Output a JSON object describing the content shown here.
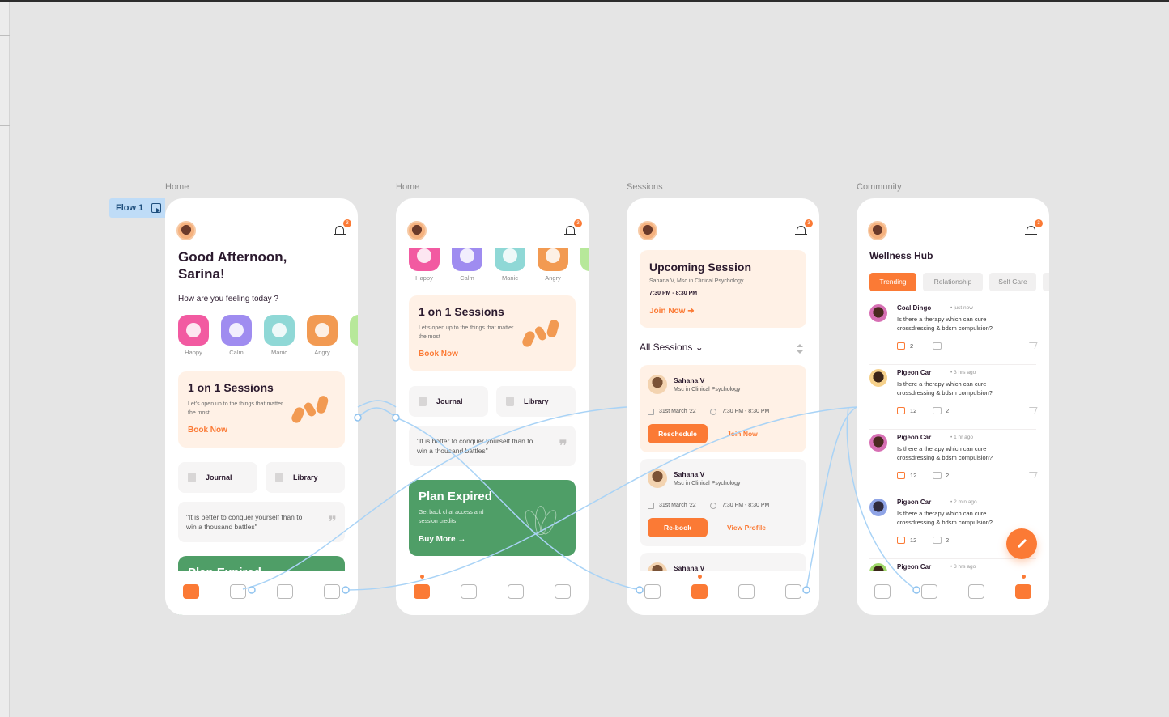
{
  "canvas": {
    "flow_tag": "Flow 1",
    "frame_labels": [
      "Home",
      "Home",
      "Sessions",
      "Community"
    ]
  },
  "home": {
    "greeting": "Good Afternoon,",
    "name": "Sarina!",
    "feeling_question": "How are you feeling today ?",
    "notification_count": "3",
    "moods": [
      {
        "label": "Happy",
        "color": "#f25aa1"
      },
      {
        "label": "Calm",
        "color": "#9f8cf0"
      },
      {
        "label": "Manic",
        "color": "#8fd8d6"
      },
      {
        "label": "Angry",
        "color": "#f29a52"
      }
    ],
    "sessions_card": {
      "title": "1 on 1 Sessions",
      "desc": "Let's open up to the things that matter the most",
      "cta": "Book Now"
    },
    "journal_label": "Journal",
    "library_label": "Library",
    "quote": "\"It is better to conquer yourself than to win a thousand battles\"",
    "plan_card": {
      "title": "Plan Expired",
      "desc": "Get back chat access and session credits",
      "cta": "Buy More"
    }
  },
  "sessions": {
    "notification_count": "3",
    "upcoming": {
      "title": "Upcoming Session",
      "who": "Sahana V, Msc in Clinical Psychology",
      "time": "7:30 PM - 8:30 PM",
      "cta": "Join Now"
    },
    "all_sessions_label": "All Sessions",
    "items": [
      {
        "name": "Sahana V",
        "degree": "Msc in Clinical Psychology",
        "date": "31st March '22",
        "time": "7:30 PM - 8:30 PM",
        "primary": "Reschedule",
        "secondary": "Join Now",
        "bg": "#fff1e6"
      },
      {
        "name": "Sahana V",
        "degree": "Msc in Clinical Psychology",
        "date": "31st March '22",
        "time": "7:30 PM - 8:30 PM",
        "primary": "Re-book",
        "secondary": "View Profile",
        "bg": "#f6f5f5"
      }
    ],
    "partial_name": "Sahana V"
  },
  "community": {
    "notification_count": "3",
    "title": "Wellness Hub",
    "chips": [
      "Trending",
      "Relationship",
      "Self Care"
    ],
    "posts": [
      {
        "name": "Coal Dingo",
        "time": "just now",
        "text": "Is there a therapy which can cure crossdressing & bdsm compulsion?",
        "likes": "2",
        "comments": ""
      },
      {
        "name": "Pigeon Car",
        "time": "3 hrs ago",
        "text": "Is there a therapy which can cure crossdressing & bdsm compulsion?",
        "likes": "12",
        "comments": "2"
      },
      {
        "name": "Pigeon Car",
        "time": "1 hr ago",
        "text": "Is there a therapy which can cure crossdressing & bdsm compulsion?",
        "likes": "12",
        "comments": "2"
      },
      {
        "name": "Pigeon Car",
        "time": "2 min ago",
        "text": "Is there a therapy which can cure crossdressing & bdsm compulsion?",
        "likes": "12",
        "comments": "2"
      }
    ],
    "partial_post": {
      "name": "Pigeon Car",
      "time": "3 hrs ago"
    }
  },
  "colors": {
    "accent": "#fb7a35",
    "green": "#4f9e67",
    "wire": "#a9d3f6"
  }
}
